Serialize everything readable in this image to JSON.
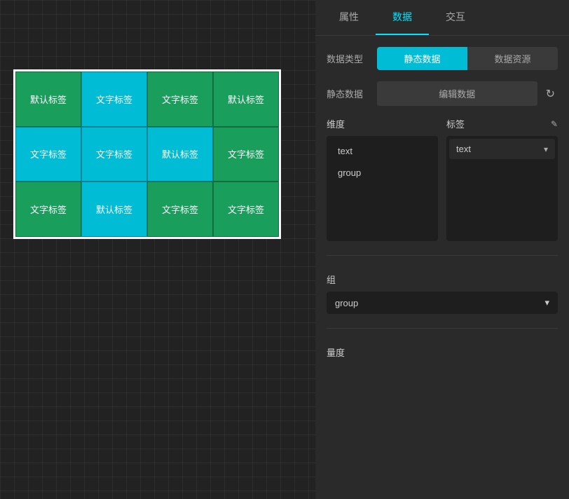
{
  "canvas": {
    "grid": {
      "rows": [
        [
          {
            "label": "默认标签",
            "type": "green"
          },
          {
            "label": "文字标签",
            "type": "cyan"
          },
          {
            "label": "文字标签",
            "type": "green"
          },
          {
            "label": "默认标签",
            "type": "green"
          }
        ],
        [
          {
            "label": "文字标签",
            "type": "cyan"
          },
          {
            "label": "文字标签",
            "type": "cyan"
          },
          {
            "label": "默认标签",
            "type": "cyan"
          },
          {
            "label": "文字标签",
            "type": "green"
          }
        ],
        [
          {
            "label": "文字标签",
            "type": "green"
          },
          {
            "label": "默认标签",
            "type": "cyan"
          },
          {
            "label": "文字标签",
            "type": "green"
          },
          {
            "label": "文字标签",
            "type": "green"
          }
        ]
      ]
    }
  },
  "panel": {
    "tabs": [
      {
        "label": "属性",
        "active": false
      },
      {
        "label": "数据",
        "active": true
      },
      {
        "label": "交互",
        "active": false
      }
    ],
    "data_type_label": "数据类型",
    "static_data_btn": "静态数据",
    "data_source_btn": "数据资源",
    "static_data_label": "静态数据",
    "edit_data_btn": "编辑数据",
    "refresh_icon": "↻",
    "dimension_label": "维度",
    "tag_label": "标签",
    "edit_icon": "✎",
    "dimension_items": [
      "text",
      "group"
    ],
    "tag_item": "text",
    "group_section_label": "组",
    "group_value": "group",
    "measure_label": "量度",
    "chevron_down": "▾"
  }
}
